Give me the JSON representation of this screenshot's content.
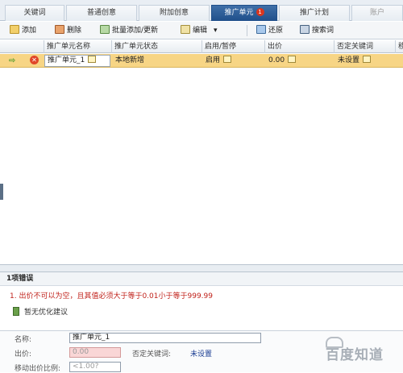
{
  "tabs": [
    {
      "label": "关键词"
    },
    {
      "label": "普通创意"
    },
    {
      "label": "附加创意"
    },
    {
      "label": "推广单元",
      "badge": "1"
    },
    {
      "label": "推广计划"
    },
    {
      "label": "账户"
    }
  ],
  "toolbar": {
    "add": "添加",
    "delete": "删除",
    "batch": "批量添加/更新",
    "edit": "编辑",
    "edit_caret": "▾",
    "restore": "还原",
    "search": "搜索词"
  },
  "grid": {
    "columns": [
      "推广单元名称",
      "推广单元状态",
      "启用/暂停",
      "出价",
      "否定关键词",
      "移"
    ],
    "rows": [
      {
        "name": "推广单元_1",
        "status": "本地新增",
        "toggle": "启用",
        "bid": "0.00",
        "negative": "未设置"
      }
    ]
  },
  "errors": {
    "title": "1项错误",
    "items": [
      "1. 出价不可以为空，且其值必须大于等于0.01小于等于999.99"
    ],
    "suggestion": "暂无优化建议"
  },
  "form": {
    "name_label": "名称:",
    "name_value": "推广单元_1",
    "bid_label": "出价:",
    "bid_value": "0.00",
    "negative_label": "否定关键词:",
    "negative_value": "未设置",
    "mobile_label": "移动出价比例:",
    "mobile_placeholder": "<1.00?"
  },
  "watermark": "百度知道",
  "colors": {
    "selected_row": "#f7d585",
    "active_tab": "#2a5a96",
    "error_text": "#c0211a"
  }
}
